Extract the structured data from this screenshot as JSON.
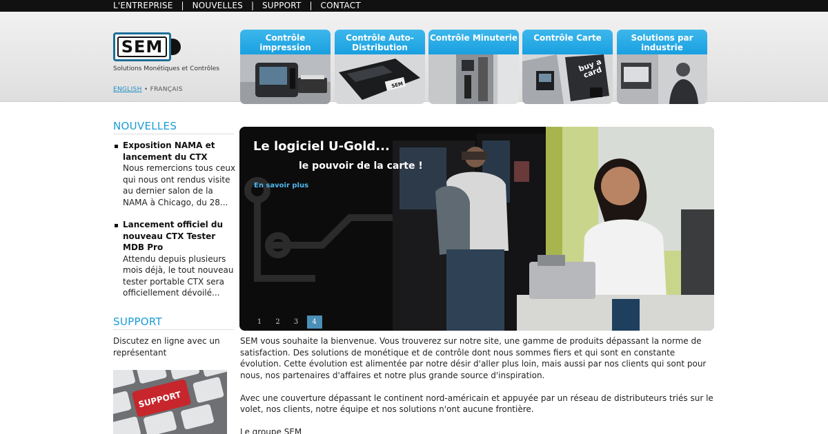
{
  "topnav": [
    "L'ENTREPRISE",
    "NOUVELLES",
    "SUPPORT",
    "CONTACT"
  ],
  "brand": {
    "logo_text": "SEM",
    "tagline": "Solutions Monétiques et Contrôles"
  },
  "languages": {
    "english": "ENGLISH",
    "separator": "•",
    "french": "FRANÇAIS"
  },
  "tiles": [
    {
      "label": "Contrôle impression"
    },
    {
      "label": "Contrôle Auto-Distribution"
    },
    {
      "label": "Contrôle Minuterie"
    },
    {
      "label": "Contrôle Carte"
    },
    {
      "label": "Solutions par industrie"
    }
  ],
  "sidebar": {
    "news_heading": "NOUVELLES",
    "news": [
      {
        "title": "Exposition NAMA et lancement du CTX",
        "body": "Nous remercions tous ceux qui nous ont rendus visite au dernier salon de la NAMA à Chicago, du 28..."
      },
      {
        "title": "Lancement officiel du nouveau CTX Tester MDB Pro",
        "body": "Attendu depuis plusieurs mois déjà, le tout nouveau tester portable CTX sera officiellement dévoilé..."
      }
    ],
    "support_heading": "SUPPORT",
    "support_text": "Discutez en ligne avec un représentant",
    "support_key_label": "SUPPORT"
  },
  "banner": {
    "title": "Le logiciel U-Gold...",
    "subtitle": "le pouvoir de la carte !",
    "link": "En savoir plus",
    "card_text": "buy a card",
    "pages": [
      "1",
      "2",
      "3",
      "4"
    ],
    "active_page": "4"
  },
  "intro": {
    "p1": "SEM vous souhaite la bienvenue. Vous trouverez sur notre site, une gamme de produits dépassant la norme de satisfaction. Des solutions de monétique et de contrôle dont nous sommes fiers et qui sont en constante évolution. Cette évolution est alimentée par notre désir d'aller plus loin, mais aussi par nos clients qui sont pour nous, nos partenaires d'affaires et notre plus grande source d'inspiration.",
    "p2": "Avec une couverture dépassant le continent nord-américain et appuyée par un réseau de distributeurs triés sur le volet, nos clients, notre équipe et nos solutions n'ont aucune frontière.",
    "p3": "Le groupe SEM"
  },
  "colors": {
    "accent": "#1a9ad6",
    "tile_blue": "#19a0e0",
    "pager_active": "#4a8fb8"
  }
}
